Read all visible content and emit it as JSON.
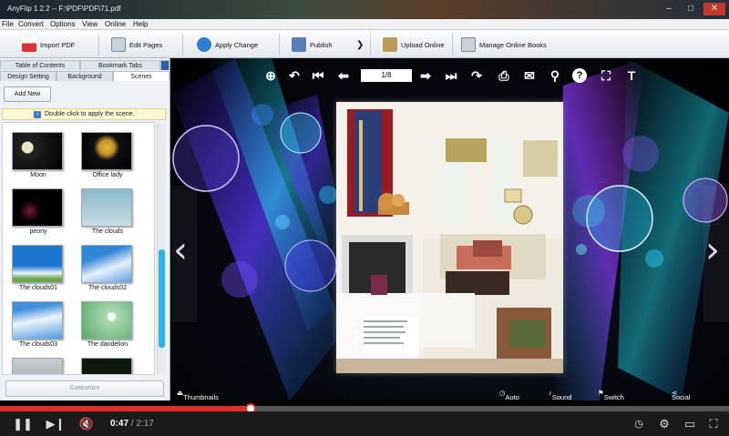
{
  "window": {
    "title": "AnyFlip 1.2.2 -- F:\\PDF\\PDF\\71.pdf",
    "min": "–",
    "max": "□",
    "close": "✕"
  },
  "menu": [
    "File",
    "Convert",
    "Options",
    "View",
    "Online",
    "Help"
  ],
  "toolbar": {
    "import_pdf": "Import PDF",
    "edit_pages": "Edit Pages",
    "apply_change": "Apply Change",
    "publish": "Publish",
    "more": "❯",
    "upload_online": "Upload Online",
    "manage_online_books": "Manage Online Books"
  },
  "panel": {
    "tabs_row1": [
      "Table of Contents",
      "Bookmark Tabs"
    ],
    "tabs_row2": [
      "Design Setting",
      "Background",
      "Scenes"
    ],
    "add_new": "Add New",
    "hint": "Double click to apply the scene.",
    "scenes": [
      "Moon",
      "Office lady",
      "peony",
      "The clouds",
      "The clouds01",
      "The clouds02",
      "The clouds03",
      "The dandelion"
    ],
    "customize": "Customize"
  },
  "flipbook": {
    "page_indicator": "1/8",
    "bottom": {
      "thumbnails": "Thumbnails",
      "auto_flip": "Auto Flip",
      "sound_on": "Sound On",
      "switch_language": "Switch Language",
      "social_share": "Social Share"
    },
    "prev_arrow": "‹",
    "next_arrow": "›"
  },
  "player": {
    "current_time": "0:47",
    "separator": " / ",
    "duration": "2:17",
    "progress_fraction": 0.344
  },
  "colors": {
    "accent_red": "#e52d27",
    "scroll_blue": "#2fb2e6"
  }
}
